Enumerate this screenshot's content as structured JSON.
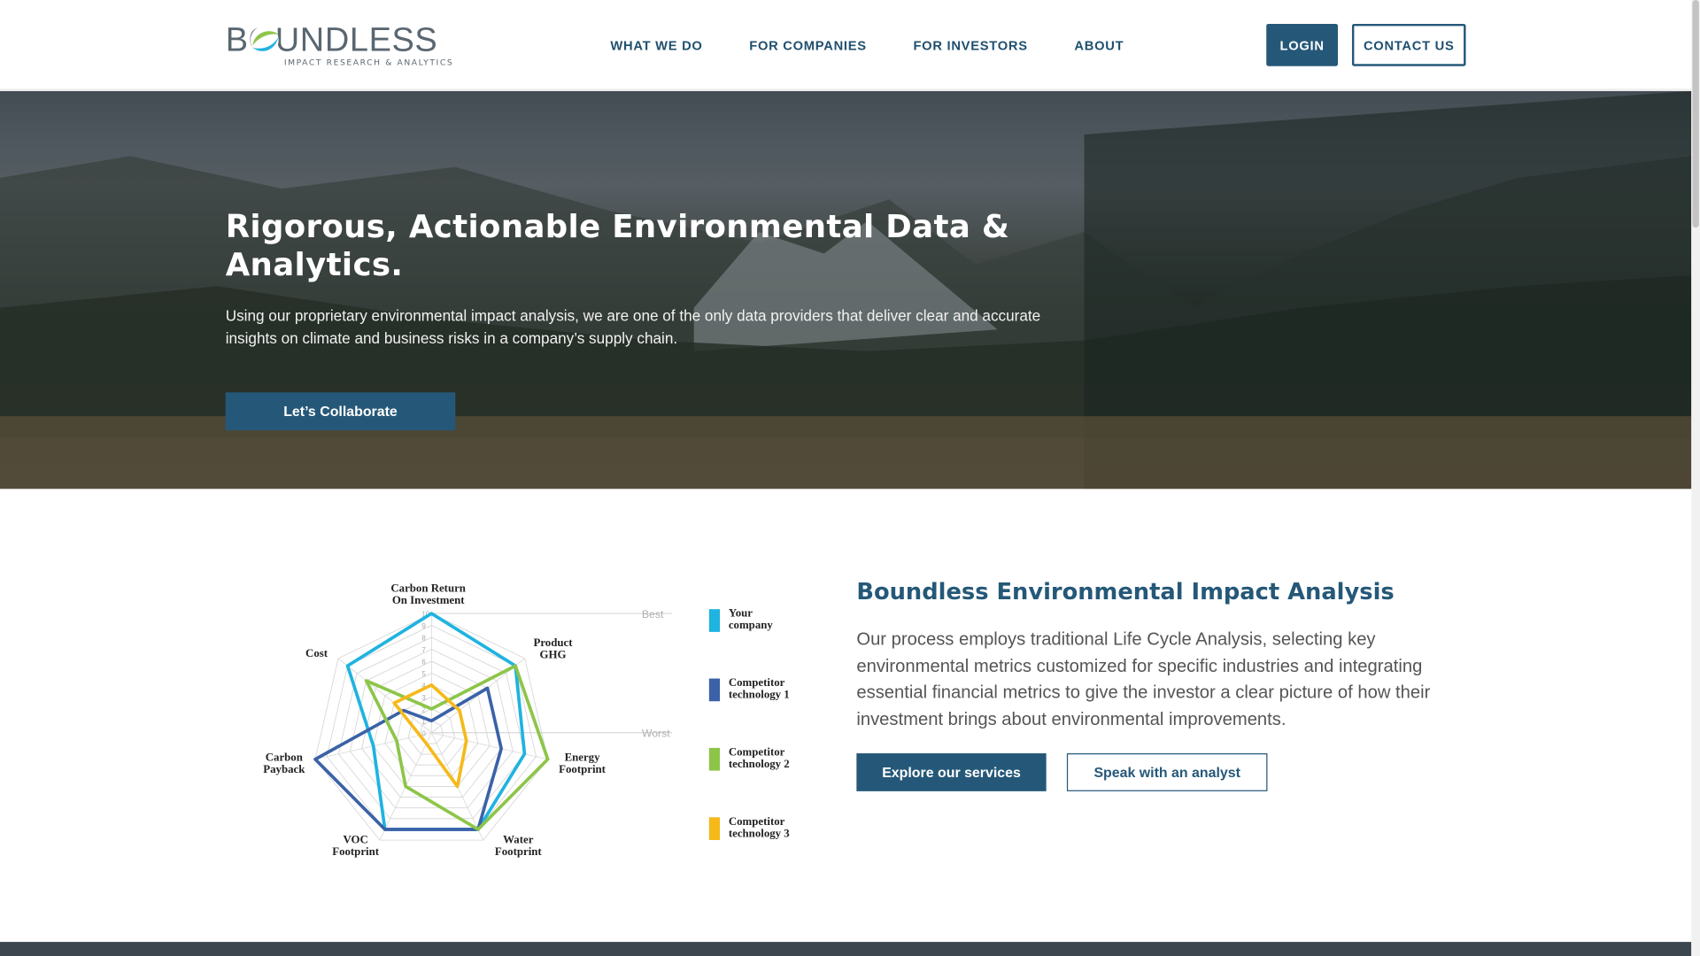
{
  "header": {
    "logo_word": "BOUNDLESS",
    "logo_sub": "IMPACT RESEARCH & ANALYTICS",
    "nav": [
      "WHAT WE DO",
      "FOR COMPANIES",
      "FOR INVESTORS",
      "ABOUT"
    ],
    "login_label": "LOGIN",
    "contact_label": "CONTACT US"
  },
  "hero": {
    "title": "Rigorous, Actionable Environmental Data & Analytics.",
    "text": "Using our proprietary environmental impact analysis, we are one of the only data providers that deliver clear and accurate insights on climate and business risks in a company’s supply chain.",
    "button_label": "Let’s Collaborate"
  },
  "section": {
    "title": "Boundless Environmental Impact Analysis",
    "text": "Our process employs traditional Life Cycle Analysis, selecting key environmental metrics customized for specific industries and integrating essential financial metrics to give the investor a clear picture of how their investment brings about environmental improvements.",
    "explore_label": "Explore our services",
    "speak_label": "Speak with an analyst"
  },
  "chart_data": {
    "type": "radar",
    "axes": [
      [
        "Carbon Return",
        "On Investment"
      ],
      [
        "Product",
        "GHG"
      ],
      [
        "Energy",
        "Footprint"
      ],
      [
        "Water",
        "Footprint"
      ],
      [
        "VOC",
        "Footprint"
      ],
      [
        "Carbon",
        "Payback"
      ],
      [
        "Cost"
      ]
    ],
    "scale_ticks": [
      "0",
      "1",
      "2",
      "3",
      "4",
      "5",
      "6",
      "7",
      "8",
      "9",
      "10"
    ],
    "best_label": "Best",
    "worst_label": "Worst",
    "range": [
      0,
      10
    ],
    "series": [
      {
        "name": "Your company",
        "legend": [
          "Your",
          "company"
        ],
        "color": "#1fb3e0",
        "values": [
          10,
          9,
          8,
          9,
          9,
          5,
          9
        ]
      },
      {
        "name": "Competitor technology 1",
        "legend": [
          "Competitor",
          "technology 1"
        ],
        "color": "#3b62a8",
        "values": [
          1,
          6,
          6,
          9,
          9,
          10,
          3
        ]
      },
      {
        "name": "Competitor technology 2",
        "legend": [
          "Competitor",
          "technology 2"
        ],
        "color": "#8dc549",
        "values": [
          2,
          9,
          10,
          9,
          5,
          3,
          7
        ]
      },
      {
        "name": "Competitor technology 3",
        "legend": [
          "Competitor",
          "technology 3"
        ],
        "color": "#f5b91a",
        "values": [
          4,
          3,
          3,
          5,
          1,
          1,
          4
        ]
      }
    ]
  }
}
